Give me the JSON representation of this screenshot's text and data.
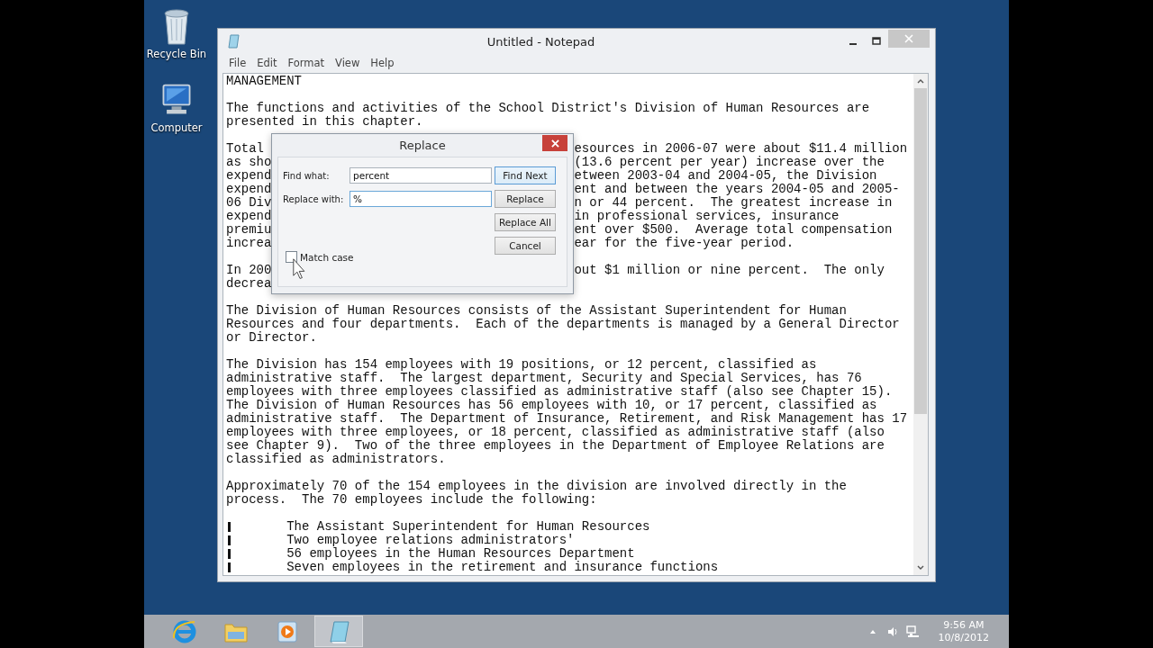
{
  "desktop_icons": [
    {
      "label": "Recycle Bin",
      "kind": "recycle"
    },
    {
      "label": "Computer",
      "kind": "computer"
    }
  ],
  "window": {
    "title": "Untitled - Notepad",
    "menu": [
      "File",
      "Edit",
      "Format",
      "View",
      "Help"
    ]
  },
  "document": {
    "paragraphs": [
      [
        {
          "text": "MANAGEMENT"
        }
      ],
      [
        {
          "text": "The functions and activities of the School District's Division of Human Resources are"
        },
        {
          "text": "presented in this chapter."
        }
      ],
      [
        {
          "left": "Total",
          "right": "esources in 2006-07 were about $11.4 million"
        },
        {
          "left": "as sho",
          "right": "(13.6 percent per year) increase over the"
        },
        {
          "left": "expend",
          "right": "etween 2003-04 and 2004-05, the Division"
        },
        {
          "left": "expend",
          "right": "ent and between the years 2004-05 and 2005-"
        },
        {
          "left": "06 Div",
          "right": "n or 44 percent.  The greatest increase in"
        },
        {
          "left": "expend",
          "right": "in professional services, insurance"
        },
        {
          "left": "premiu",
          "right": "ent over $500.  Average total compensation"
        },
        {
          "left": "increa",
          "right": "ear for the five-year period."
        }
      ],
      [
        {
          "left": "In 200",
          "right": "out $1 million or nine percent.  The only"
        },
        {
          "left": "decrea"
        }
      ],
      [
        {
          "text": "The Division of Human Resources consists of the Assistant Superintendent for Human"
        },
        {
          "text": "Resources and four departments.  Each of the departments is managed by a General Director"
        },
        {
          "text": "or Director."
        }
      ],
      [
        {
          "text": "The Division has 154 employees with 19 positions, or 12 percent, classified as"
        },
        {
          "text": "administrative staff.  The largest department, Security and Special Services, has 76"
        },
        {
          "text": "employees with three employees classified as administrative staff (also see Chapter 15)."
        },
        {
          "text": "The Division of Human Resources has 56 employees with 10, or 17 percent, classified as"
        },
        {
          "text": "administrative staff.  The Department of Insurance, Retirement, and Risk Management has 17"
        },
        {
          "text": "employees with three employees, or 18 percent, classified as administrative staff (also"
        },
        {
          "text": "see Chapter 9).  Two of the three employees in the Department of Employee Relations are"
        },
        {
          "text": "classified as administrators."
        }
      ],
      [
        {
          "text": "Approximately 70 of the 154 employees in the division are involved directly in the"
        },
        {
          "text": "process.  The 70 employees include the following:"
        }
      ],
      [
        {
          "kind": "bullet",
          "text": "The Assistant Superintendent for Human Resources"
        },
        {
          "kind": "bullet",
          "text": "Two employee relations administrators'"
        },
        {
          "kind": "bullet",
          "text": "56 employees in the Human Resources Department"
        },
        {
          "kind": "bullet",
          "text": "Seven employees in the retirement and insurance functions"
        }
      ]
    ]
  },
  "dialog": {
    "title": "Replace",
    "fields": [
      {
        "label": "Find what:",
        "value": "percent",
        "focused": false
      },
      {
        "label": "Replace with:",
        "value": "%",
        "focused": true
      }
    ],
    "buttons": [
      {
        "label": "Find Next",
        "default": true
      },
      {
        "label": "Replace",
        "default": false
      },
      {
        "label": "Replace All",
        "default": false
      },
      {
        "label": "Cancel",
        "default": false
      }
    ],
    "match_case": {
      "label": "Match case",
      "checked": false
    }
  },
  "taskbar": {
    "apps": [
      {
        "kind": "ie",
        "active": false
      },
      {
        "kind": "explorer",
        "active": false
      },
      {
        "kind": "media",
        "active": false
      },
      {
        "kind": "notepad",
        "active": true
      }
    ],
    "time": "9:56 AM",
    "date": "10/8/2012"
  }
}
